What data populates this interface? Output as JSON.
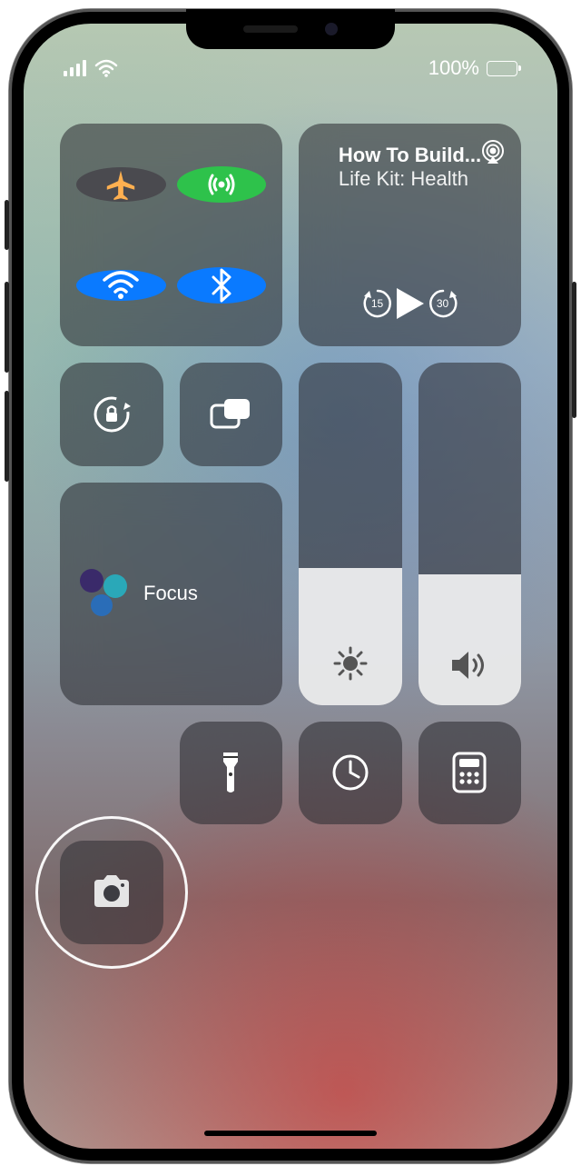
{
  "status": {
    "battery_pct": "100%",
    "battery_fill": 100
  },
  "connectivity": {
    "airplane": {
      "active": false,
      "bg": "#444",
      "fg": "#ffb050"
    },
    "cellular": {
      "active": true,
      "bg": "#2ec24b",
      "fg": "#fff"
    },
    "wifi": {
      "active": true,
      "bg": "#0a7aff",
      "fg": "#fff"
    },
    "bluetooth": {
      "active": true,
      "bg": "#0a7aff",
      "fg": "#fff"
    }
  },
  "media": {
    "title": "How To Build...",
    "subtitle": "Life Kit: Health",
    "skip_back": "15",
    "skip_fwd": "30"
  },
  "focus": {
    "label": "Focus"
  },
  "sliders": {
    "brightness_pct": 40,
    "volume_pct": 38
  },
  "highlight": {
    "target": "camera-button"
  }
}
